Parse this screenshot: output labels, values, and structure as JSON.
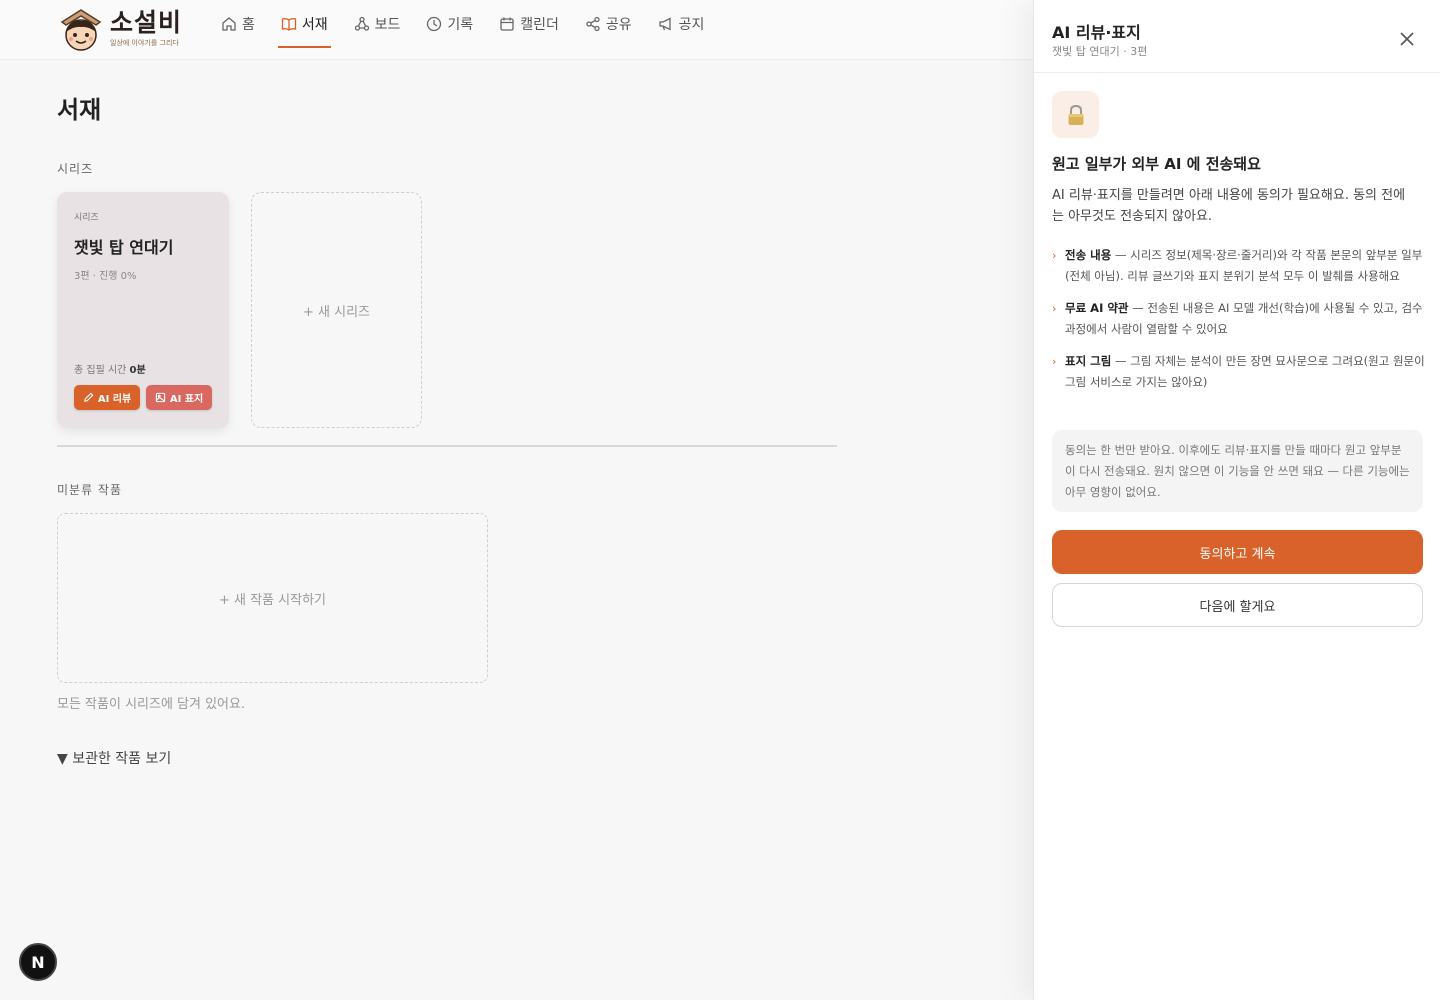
{
  "header": {
    "logo_title": "소설비",
    "logo_subtitle": "일상에 이야기를 그리다",
    "nav": [
      {
        "label": "홈",
        "icon": "home-icon"
      },
      {
        "label": "서재",
        "icon": "book-icon",
        "active": true
      },
      {
        "label": "보드",
        "icon": "board-icon"
      },
      {
        "label": "기록",
        "icon": "clock-icon"
      },
      {
        "label": "캘린더",
        "icon": "calendar-icon"
      },
      {
        "label": "공유",
        "icon": "share-icon"
      },
      {
        "label": "공지",
        "icon": "megaphone-icon"
      }
    ]
  },
  "main": {
    "title": "서재",
    "series_section_label": "시리즈",
    "series_card": {
      "kicker": "시리즈",
      "name": "잿빛 탑 연대기",
      "meta": "3편 · 진행 0%",
      "time_label": "총 집필 시간",
      "time_value": "0분",
      "ai_review_label": "AI 리뷰",
      "ai_cover_label": "AI 표지"
    },
    "new_series_label": "+ 새 시리즈",
    "uncategorized_label": "미분류 작품",
    "new_work_label": "+ 새 작품 시작하기",
    "note": "모든 작품이 시리즈에 담겨 있어요.",
    "archived_toggle": "▼ 보관한 작품 보기"
  },
  "badge": {
    "label": "N"
  },
  "panel": {
    "title": "AI 리뷰·표지",
    "subtitle": "잿빛 탑 연대기 · 3편",
    "heading": "원고 일부가 외부 AI 에 전송돼요",
    "description": "AI 리뷰·표지를 만들려면 아래 내용에 동의가 필요해요. 동의 전에는 아무것도 전송되지 않아요.",
    "bullets": [
      {
        "title": "전송 내용",
        "text": " — 시리즈 정보(제목·장르·줄거리)와 각 작품 본문의 앞부분 일부(전체 아님). 리뷰 글쓰기와 표지 분위기 분석 모두 이 발췌를 사용해요"
      },
      {
        "title": "무료 AI 약관",
        "text": " — 전송된 내용은 AI 모델 개선(학습)에 사용될 수 있고, 검수 과정에서 사람이 열람할 수 있어요"
      },
      {
        "title": "표지 그림",
        "text": " — 그림 자체는 분석이 만든 장면 묘사문으로 그려요(원고 원문이 그림 서비스로 가지는 않아요)"
      }
    ],
    "info": "동의는 한 번만 받아요. 이후에도 리뷰·표지를 만들 때마다 원고 앞부분이 다시 전송돼요. 원치 않으면 이 기능을 안 쓰면 돼요 — 다른 기능에는 아무 영향이 없어요.",
    "agree_button": "동의하고 계속",
    "later_button": "다음에 할게요"
  },
  "colors": {
    "accent": "#d9622b",
    "card_bg": "#e8e2e4"
  }
}
